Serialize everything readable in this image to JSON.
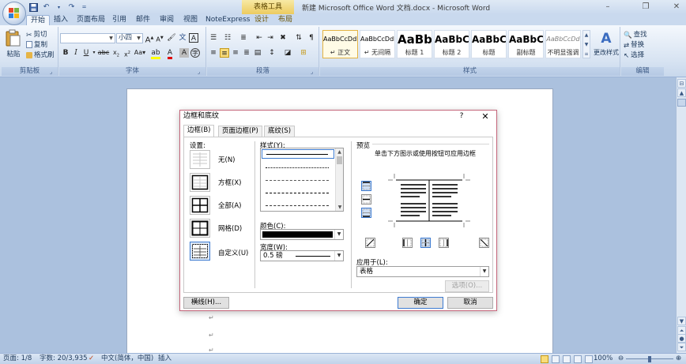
{
  "window": {
    "title": "新建 Microsoft Office Word 文档.docx - Microsoft Word",
    "context_tab_group": "表格工具"
  },
  "tabs": [
    {
      "label": "开始",
      "active": true
    },
    {
      "label": "插入"
    },
    {
      "label": "页面布局"
    },
    {
      "label": "引用"
    },
    {
      "label": "邮件"
    },
    {
      "label": "审阅"
    },
    {
      "label": "视图"
    },
    {
      "label": "NoteExpress"
    },
    {
      "label": "设计",
      "contextual": true
    },
    {
      "label": "布局",
      "contextual": true
    }
  ],
  "ribbon": {
    "clipboard": {
      "label": "剪贴板",
      "paste": "粘贴",
      "cut": "剪切",
      "copy": "复制",
      "format_painter": "格式刷"
    },
    "font": {
      "label": "字体",
      "font_name": "",
      "font_size": "小四"
    },
    "paragraph": {
      "label": "段落"
    },
    "styles": {
      "label": "样式",
      "items": [
        {
          "sample": "AaBbCcDdl",
          "name": "↵ 正文",
          "selected": true
        },
        {
          "sample": "AaBbCcDdl",
          "name": "↵ 无间隔"
        },
        {
          "sample": "AaBb",
          "name": "标题 1"
        },
        {
          "sample": "AaBbC",
          "name": "标题 2"
        },
        {
          "sample": "AaBbC",
          "name": "标题"
        },
        {
          "sample": "AaBbC",
          "name": "副标题"
        },
        {
          "sample": "AaBbCcDd",
          "name": "不明显强调"
        }
      ],
      "change_styles": "更改样式"
    },
    "editing": {
      "label": "编辑",
      "find": "查找",
      "replace": "替换",
      "select": "选择"
    }
  },
  "dialog": {
    "title": "边框和底纹",
    "help": "?",
    "close": "✕",
    "tabs": [
      {
        "label": "边框(B)",
        "active": true
      },
      {
        "label": "页面边框(P)"
      },
      {
        "label": "底纹(S)"
      }
    ],
    "settings_label": "设置:",
    "settings": [
      {
        "label": "无(N)"
      },
      {
        "label": "方框(X)"
      },
      {
        "label": "全部(A)"
      },
      {
        "label": "网格(D)"
      },
      {
        "label": "自定义(U)",
        "selected": true
      }
    ],
    "style_label": "样式(Y):",
    "color_label": "颜色(C):",
    "color_value": "#000000",
    "width_label": "宽度(W):",
    "width_value": "0.5 磅",
    "preview_label": "预览",
    "preview_hint": "单击下方图示或使用按钮可应用边框",
    "apply_to_label": "应用于(L):",
    "apply_to_value": "表格",
    "options_button": "选项(O)...",
    "horizontal_line_button": "横线(H)...",
    "ok_button": "确定",
    "cancel_button": "取消"
  },
  "statusbar": {
    "page": "页面: 1/8",
    "words": "字数: 20/3,935",
    "language": "中文(简体，中国)",
    "insert_mode": "插入",
    "zoom": "100%"
  }
}
